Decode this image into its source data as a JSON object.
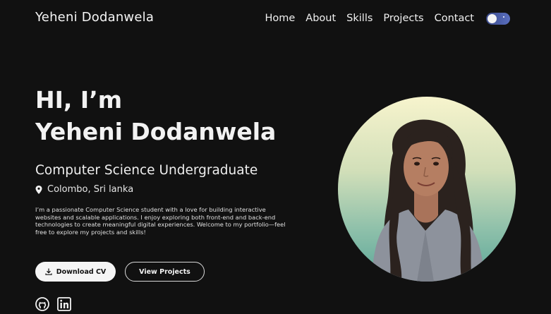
{
  "nav": {
    "brand": "Yeheni Dodanwela",
    "links": [
      "Home",
      "About",
      "Skills",
      "Projects",
      "Contact"
    ]
  },
  "hero": {
    "greeting": "HI, I’m",
    "name": "Yeheni Dodanwela",
    "role": "Computer Science Undergraduate",
    "location": "Colombo, Sri lanka",
    "bio": "I’m a passionate Computer Science student with a love for building interactive websites and scalable applications. I enjoy exploring both front-end and back-end technologies to create meaningful digital experiences. Welcome to my portfolio—feel free to explore my projects and skills!",
    "download_label": "Download CV",
    "projects_label": "View Projects"
  },
  "icons": {
    "location": "map-pin-icon",
    "download": "download-icon",
    "social": [
      "github-icon",
      "linkedin-icon"
    ],
    "theme_toggle": "dark-mode-toggle"
  },
  "colors": {
    "background": "#111111",
    "text": "#f2f2f2",
    "toggle": "#4a5ba8"
  }
}
